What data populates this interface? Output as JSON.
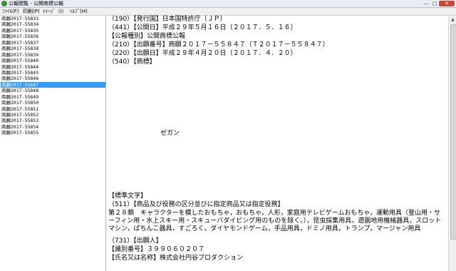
{
  "window": {
    "title": "公報閲覧 - 公開商標公報",
    "controls": {
      "minimize": "—",
      "maximize": "□",
      "close": "✕"
    }
  },
  "menu": [
    "ﾌｧｲﾙ(F)",
    "印刷(P)",
    "ｲﾒｰｼﾞ（I）",
    "ﾍﾙﾌﾟ(H)"
  ],
  "list": {
    "items": [
      "商願2017-55833",
      "商願2017-55834",
      "商願2017-55835",
      "商願2017-55836",
      "商願2017-55837",
      "商願2017-55838",
      "商願2017-55839",
      "商願2017-55840",
      "商願2017-55844",
      "商願2017-55845",
      "商願2017-55846",
      "商願2017-55847",
      "商願2017-55848",
      "商願2017-55849",
      "商願2017-55850",
      "商願2017-55851",
      "商願2017-55852",
      "商願2017-55853",
      "商願2017-55854",
      "商願2017-55855"
    ],
    "selected": "商願2017-55847"
  },
  "detail": {
    "lines": [
      "（190）【発行国】日本国特許庁（ＪＰ）",
      "（441）【公開日】平成２９年５月１６日（２０１７．５．１６）",
      "【公報種別】公開商標公報",
      "（210）【出願番号】商願２０１７－５５８４７（Ｔ２０１７－５５８４７）",
      "（220）【出願日】平成２９年４月２０日（２０１７．４．２０）",
      "（540）【商標】"
    ],
    "trademark_text": "ゼガン",
    "lines_bottom": [
      "【標準文字】",
      "（511）【商品及び役務の区分並びに指定商品又は指定役務】"
    ],
    "goods_paragraph": "第２８類　キャラクターを模したおもちゃ，おもちゃ，人形，家庭用テレビゲームおもちゃ，運動用具（登山用・サーフィン用・水上スキー用・スキューバダイビング用のものを除く。），昆虫採集用具，遊園地用機械器具，スロットマシン，ぱちんこ器具，すごろく，ダイヤモンドゲーム，手品用具，ドミノ用具，トランプ，マージャン用具",
    "lines_end": [
      "（731）【出願人】",
      "【識別番号】３９９０６０２０７",
      "【氏名又は名称】株式会社円谷プロダクション"
    ]
  },
  "colors": {
    "selection": "#3399ff",
    "close_button": "#c9483b",
    "app_icon": "#3d8a3d"
  },
  "icons": {
    "app": "app-icon",
    "scroll_up": "scroll-up-arrow-icon"
  }
}
